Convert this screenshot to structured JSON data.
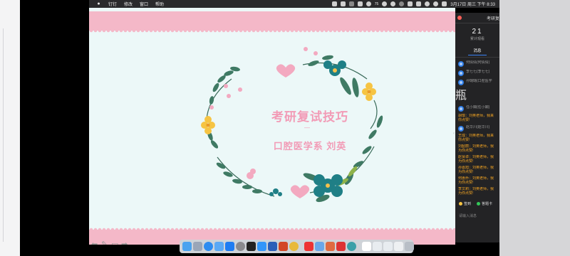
{
  "menubar": {
    "app_name": "钉钉",
    "menus": [
      "修改",
      "窗口",
      "帮助"
    ],
    "battery": "75",
    "datetime": "3月17日 周三 下午 8:33"
  },
  "slide": {
    "title": "考研复试技巧",
    "dash": "—",
    "subtitle": "口腔医学系  刘英",
    "colors": {
      "band": "#f4b8c8",
      "text": "#f29bb6",
      "background": "#ecf8f8"
    }
  },
  "panel": {
    "title": "考研复",
    "count": "21",
    "count_label": "累计观看",
    "tab": "消息",
    "viewers": [
      {
        "text": "何倩倩(何倩倩)"
      },
      {
        "text": "李七七(李七七)"
      },
      {
        "text": "孙璐璐(口腔医学",
        "extra": "瓶"
      },
      {
        "text": "任小嫻(任小嫻)"
      },
      {
        "text": "赵华川(赵华川)"
      }
    ],
    "messages": [
      {
        "line1": "胡琪：刘英老师，我来",
        "line2": "你点赞!"
      },
      {
        "line1": "王成：刘英老师，我来",
        "line2": "你点赞!"
      },
      {
        "line1": "刘韶丽：刘英老师，我",
        "line2": "为你点赞!"
      },
      {
        "line1": "赵贤卓：刘英老师，我",
        "line2": "为你点赞!"
      },
      {
        "line1": "孙嘉旭：刘英老师，我",
        "line2": "为你点赞!"
      },
      {
        "line1": "何惠乔：刘英老师，我",
        "line2": "为你点赞!"
      },
      {
        "line1": "李文莉：刘英老师，我",
        "line2": "为你点赞!"
      }
    ],
    "signin_label": "签到",
    "quiz_label": "答题卡",
    "input_placeholder": "请输入消息",
    "collapse_glyph": "‹"
  },
  "nav": {
    "prev": "⬅",
    "pen": "✎",
    "screen": "▭",
    "next": "➡"
  },
  "dock": {
    "apps": [
      "finder-icon",
      "launchpad-icon",
      "safari-icon",
      "mail-icon",
      "appstore-icon",
      "settings-icon",
      "qq-icon",
      "dingtalk-icon",
      "word-icon",
      "powerpoint-icon",
      "chrome-icon",
      "netease-icon",
      "preview-icon",
      "photos-icon",
      "wps-icon",
      "pages-icon",
      "folder-icon",
      "trash-icon"
    ]
  }
}
